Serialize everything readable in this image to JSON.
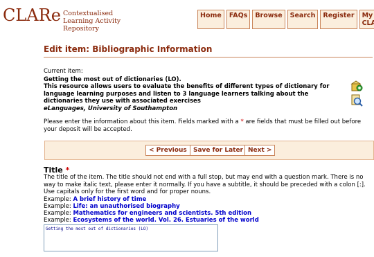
{
  "header": {
    "logo_main": "CLARe",
    "logo_sub": "Contextualised Learning Activity Repository",
    "nav": [
      "Home",
      "FAQs",
      "Browse",
      "Search",
      "Register",
      "My CLARe"
    ]
  },
  "page": {
    "title": "Edit item: Bibliographic Information"
  },
  "current_item": {
    "label": "Current item:",
    "title": "Getting the most out of dictionaries (LO).",
    "description": "This resource allows users to evaluate the benefits of different types of dictionary for language learning purposes and listen to 3 language learners talking about the dictionaries they use with associated exercises",
    "author": "eLanguages, University of Southampton"
  },
  "instructions": {
    "before": "Please enter the information about this item. Fields marked with a ",
    "star": "*",
    "after": " are fields that must be filled out before your deposit will be accepted."
  },
  "buttons": {
    "previous": "< Previous",
    "save_later": "Save for Later",
    "next": "Next >"
  },
  "field": {
    "title": "Title",
    "star": "*",
    "help": "The title of the item. The title should not end with a full stop, but may end with a question mark. There is no way to make italic text, please enter it normally. If you have a subtitle, it should be preceded with a colon [:]. Use capitals only for the first word and for proper nouns.",
    "example_label": "Example:",
    "examples": [
      "A brief history of time",
      "Life: an unauthorised biography",
      "Mathematics for engineers and scientists. 5th edition",
      "Ecosystems of the world. Vol. 26. Estuaries of the world"
    ],
    "value": "Getting the most out of dictionaries (LO)"
  }
}
